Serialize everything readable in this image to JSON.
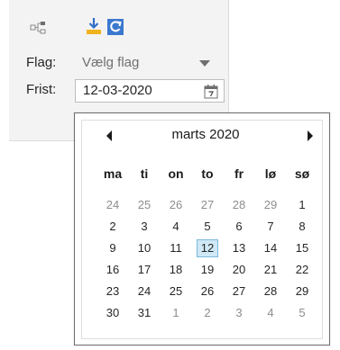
{
  "toolbar": {
    "icons": [
      "rules-icon",
      "download-icon",
      "refresh-icon"
    ]
  },
  "fields": {
    "flag_label": "Flag:",
    "flag_value": "Vælg flag",
    "due_label": "Frist:",
    "due_value": "12-03-2020"
  },
  "calendar": {
    "month_title": "marts 2020",
    "weekdays": [
      "ma",
      "ti",
      "on",
      "to",
      "fr",
      "lø",
      "sø"
    ],
    "weeks": [
      [
        {
          "d": "24",
          "o": true
        },
        {
          "d": "25",
          "o": true
        },
        {
          "d": "26",
          "o": true
        },
        {
          "d": "27",
          "o": true
        },
        {
          "d": "28",
          "o": true
        },
        {
          "d": "29",
          "o": true
        },
        {
          "d": "1"
        }
      ],
      [
        {
          "d": "2"
        },
        {
          "d": "3"
        },
        {
          "d": "4"
        },
        {
          "d": "5"
        },
        {
          "d": "6"
        },
        {
          "d": "7"
        },
        {
          "d": "8"
        }
      ],
      [
        {
          "d": "9"
        },
        {
          "d": "10"
        },
        {
          "d": "11"
        },
        {
          "d": "12",
          "s": true
        },
        {
          "d": "13"
        },
        {
          "d": "14"
        },
        {
          "d": "15"
        }
      ],
      [
        {
          "d": "16"
        },
        {
          "d": "17"
        },
        {
          "d": "18"
        },
        {
          "d": "19"
        },
        {
          "d": "20"
        },
        {
          "d": "21"
        },
        {
          "d": "22"
        }
      ],
      [
        {
          "d": "23"
        },
        {
          "d": "24"
        },
        {
          "d": "25"
        },
        {
          "d": "26"
        },
        {
          "d": "27"
        },
        {
          "d": "28"
        },
        {
          "d": "29"
        }
      ],
      [
        {
          "d": "30"
        },
        {
          "d": "31"
        },
        {
          "d": "1",
          "o": true
        },
        {
          "d": "2",
          "o": true
        },
        {
          "d": "3",
          "o": true
        },
        {
          "d": "4",
          "o": true
        },
        {
          "d": "5",
          "o": true
        }
      ]
    ]
  },
  "colors": {
    "accent": "#2f6fc5",
    "selected_bg": "#cfe8f5",
    "selected_border": "#7ab9de",
    "download_yellow": "#f0b31c"
  }
}
